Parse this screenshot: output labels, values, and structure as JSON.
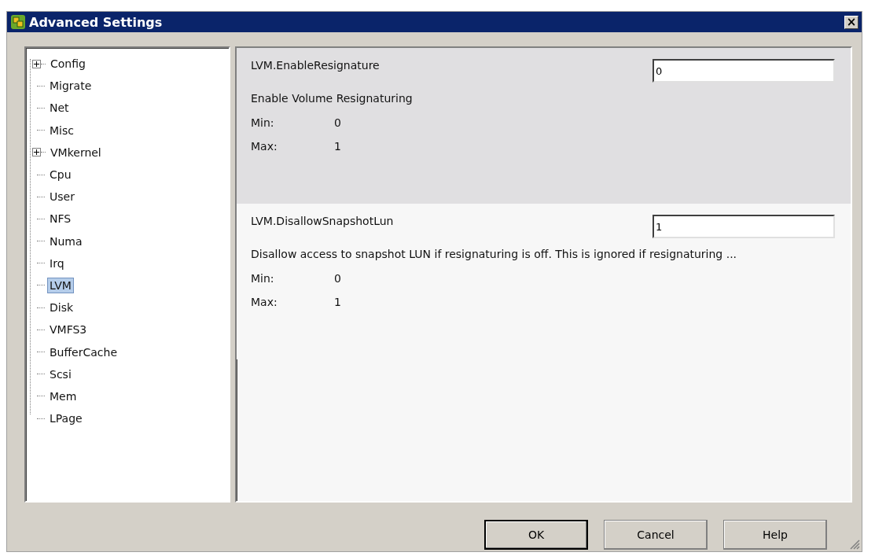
{
  "window": {
    "title": "Advanced Settings",
    "close": "×"
  },
  "tree": [
    {
      "label": "Config",
      "expandable": true,
      "selected": false
    },
    {
      "label": "Migrate",
      "expandable": false,
      "selected": false
    },
    {
      "label": "Net",
      "expandable": false,
      "selected": false
    },
    {
      "label": "Misc",
      "expandable": false,
      "selected": false
    },
    {
      "label": "VMkernel",
      "expandable": true,
      "selected": false
    },
    {
      "label": "Cpu",
      "expandable": false,
      "selected": false
    },
    {
      "label": "User",
      "expandable": false,
      "selected": false
    },
    {
      "label": "NFS",
      "expandable": false,
      "selected": false
    },
    {
      "label": "Numa",
      "expandable": false,
      "selected": false
    },
    {
      "label": "Irq",
      "expandable": false,
      "selected": false
    },
    {
      "label": "LVM",
      "expandable": false,
      "selected": true
    },
    {
      "label": "Disk",
      "expandable": false,
      "selected": false
    },
    {
      "label": "VMFS3",
      "expandable": false,
      "selected": false
    },
    {
      "label": "BufferCache",
      "expandable": false,
      "selected": false
    },
    {
      "label": "Scsi",
      "expandable": false,
      "selected": false
    },
    {
      "label": "Mem",
      "expandable": false,
      "selected": false
    },
    {
      "label": "LPage",
      "expandable": false,
      "selected": false
    }
  ],
  "settings": [
    {
      "name": "LVM.EnableResignature",
      "value": "0",
      "description": "Enable Volume Resignaturing",
      "min_label": "Min:",
      "min": "0",
      "max_label": "Max:",
      "max": "1",
      "selected": true
    },
    {
      "name": "LVM.DisallowSnapshotLun",
      "value": "1",
      "description": "Disallow access to snapshot LUN if resignaturing is off. This is ignored if resignaturing ...",
      "min_label": "Min:",
      "min": "0",
      "max_label": "Max:",
      "max": "1",
      "selected": false
    }
  ],
  "buttons": [
    {
      "label": "OK",
      "default": true
    },
    {
      "label": "Cancel",
      "default": false
    },
    {
      "label": "Help",
      "default": false
    }
  ]
}
